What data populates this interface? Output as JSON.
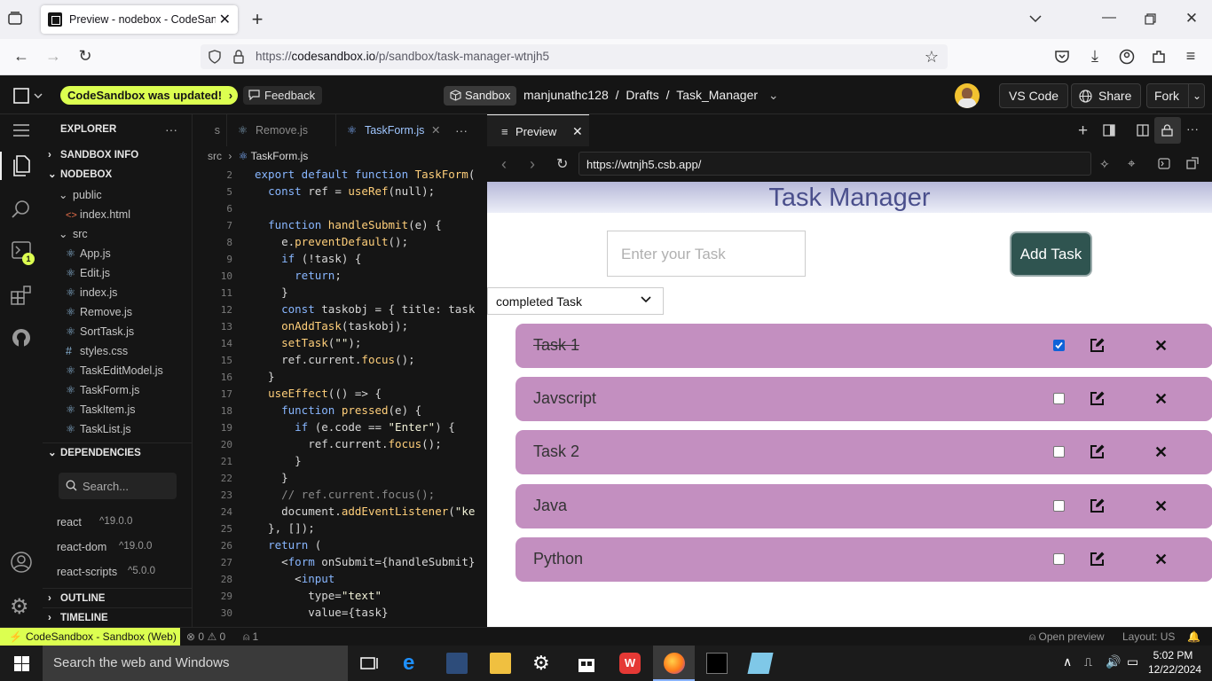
{
  "browser": {
    "tab_title": "Preview - nodebox - CodeSandbox",
    "url": "https://codesandbox.io/p/sandbox/task-manager-wtnjh5",
    "url_host": "codesandbox.io",
    "url_prefix": "https://",
    "url_path": "/p/sandbox/task-manager-wtnjh5"
  },
  "csb_header": {
    "updated_label": "CodeSandbox was updated!",
    "feedback_label": "Feedback",
    "sandbox_label": "Sandbox",
    "breadcrumb": [
      "manjunathc128",
      "/",
      "Drafts",
      "/",
      "Task_Manager"
    ],
    "vscode_label": "VS Code",
    "share_label": "Share",
    "fork_label": "Fork"
  },
  "explorer": {
    "title": "EXPLORER",
    "sections": {
      "sandbox_info": "SANDBOX INFO",
      "nodebox": "NODEBOX",
      "dependencies": "DEPENDENCIES",
      "outline": "OUTLINE",
      "timeline": "TIMELINE"
    },
    "public_folder": "public",
    "public_files": [
      "index.html"
    ],
    "src_folder": "src",
    "src_files": [
      "App.js",
      "Edit.js",
      "index.js",
      "Remove.js",
      "SortTask.js",
      "styles.css",
      "TaskEditModel.js",
      "TaskForm.js",
      "TaskItem.js",
      "TaskList.js"
    ],
    "search_placeholder": "Search...",
    "dependencies": [
      {
        "name": "react",
        "version": "^19.0.0"
      },
      {
        "name": "react-dom",
        "version": "^19.0.0"
      },
      {
        "name": "react-scripts",
        "version": "^5.0.0"
      }
    ]
  },
  "editor": {
    "tabs": [
      "s",
      "Remove.js",
      "TaskForm.js"
    ],
    "breadcrumb": [
      "src",
      "TaskForm.js"
    ],
    "lines": [
      {
        "n": "2",
        "tokens": [
          [
            "kw",
            "export default function "
          ],
          [
            "fn",
            "TaskForm"
          ],
          [
            "",
            "("
          ]
        ]
      },
      {
        "n": "5",
        "tokens": [
          [
            "",
            "  "
          ],
          [
            "kw",
            "const "
          ],
          [
            "",
            "ref = "
          ],
          [
            "fn",
            "useRef"
          ],
          [
            "",
            "(null);"
          ]
        ]
      },
      {
        "n": "6",
        "tokens": [
          [
            "",
            ""
          ]
        ]
      },
      {
        "n": "7",
        "tokens": [
          [
            "",
            "  "
          ],
          [
            "kw",
            "function "
          ],
          [
            "fn",
            "handleSubmit"
          ],
          [
            "",
            "(e) {"
          ]
        ]
      },
      {
        "n": "8",
        "tokens": [
          [
            "",
            "    e."
          ],
          [
            "fn",
            "preventDefault"
          ],
          [
            "",
            "();"
          ]
        ]
      },
      {
        "n": "9",
        "tokens": [
          [
            "",
            "    "
          ],
          [
            "kw",
            "if "
          ],
          [
            "",
            "(!task) {"
          ]
        ]
      },
      {
        "n": "10",
        "tokens": [
          [
            "",
            "      "
          ],
          [
            "kw",
            "return"
          ],
          [
            "",
            ";"
          ]
        ]
      },
      {
        "n": "11",
        "tokens": [
          [
            "",
            "    }"
          ]
        ]
      },
      {
        "n": "12",
        "tokens": [
          [
            "",
            "    "
          ],
          [
            "kw",
            "const "
          ],
          [
            "",
            "taskobj = { title: task"
          ]
        ]
      },
      {
        "n": "13",
        "tokens": [
          [
            "",
            "    "
          ],
          [
            "fn",
            "onAddTask"
          ],
          [
            "",
            "(taskobj);"
          ]
        ]
      },
      {
        "n": "14",
        "tokens": [
          [
            "",
            "    "
          ],
          [
            "fn",
            "setTask"
          ],
          [
            "",
            "("
          ],
          [
            "str",
            "\"\""
          ],
          [
            "",
            ");"
          ]
        ]
      },
      {
        "n": "15",
        "tokens": [
          [
            "",
            "    ref.current."
          ],
          [
            "fn",
            "focus"
          ],
          [
            "",
            "();"
          ]
        ]
      },
      {
        "n": "16",
        "tokens": [
          [
            "",
            "  }"
          ]
        ]
      },
      {
        "n": "17",
        "tokens": [
          [
            "",
            "  "
          ],
          [
            "fn",
            "useEffect"
          ],
          [
            "",
            "(() => {"
          ]
        ]
      },
      {
        "n": "18",
        "tokens": [
          [
            "",
            "    "
          ],
          [
            "kw",
            "function "
          ],
          [
            "fn",
            "pressed"
          ],
          [
            "",
            "(e) {"
          ]
        ]
      },
      {
        "n": "19",
        "tokens": [
          [
            "",
            "      "
          ],
          [
            "kw",
            "if "
          ],
          [
            "",
            "(e.code == "
          ],
          [
            "str",
            "\"Enter\""
          ],
          [
            "",
            ") {"
          ]
        ]
      },
      {
        "n": "20",
        "tokens": [
          [
            "",
            "        ref.current."
          ],
          [
            "fn",
            "focus"
          ],
          [
            "",
            "();"
          ]
        ]
      },
      {
        "n": "21",
        "tokens": [
          [
            "",
            "      }"
          ]
        ]
      },
      {
        "n": "22",
        "tokens": [
          [
            "",
            "    }"
          ]
        ]
      },
      {
        "n": "23",
        "tokens": [
          [
            "cm",
            "    // ref.current.focus();"
          ]
        ]
      },
      {
        "n": "24",
        "tokens": [
          [
            "",
            "    document."
          ],
          [
            "fn",
            "addEventListener"
          ],
          [
            "",
            "("
          ],
          [
            "str",
            "\"ke"
          ]
        ]
      },
      {
        "n": "25",
        "tokens": [
          [
            "",
            "  }, []);"
          ]
        ]
      },
      {
        "n": "26",
        "tokens": [
          [
            "",
            "  "
          ],
          [
            "kw",
            "return "
          ],
          [
            "",
            "("
          ]
        ]
      },
      {
        "n": "27",
        "tokens": [
          [
            "",
            "    <"
          ],
          [
            "kw",
            "form "
          ],
          [
            "",
            "onSubmit={handleSubmit}"
          ]
        ]
      },
      {
        "n": "28",
        "tokens": [
          [
            "",
            "      <"
          ],
          [
            "kw",
            "input"
          ]
        ]
      },
      {
        "n": "29",
        "tokens": [
          [
            "",
            "        type="
          ],
          [
            "str",
            "\"text\""
          ]
        ]
      },
      {
        "n": "30",
        "tokens": [
          [
            "",
            "        value={task}"
          ]
        ]
      }
    ]
  },
  "preview": {
    "tab_label": "Preview",
    "url": "https://wtnjh5.csb.app/",
    "app": {
      "heading": "Task Manager",
      "input_placeholder": "Enter your Task",
      "add_button": "Add Task",
      "filter_value": "completed Task",
      "tasks": [
        {
          "title": "Task 1",
          "completed": true
        },
        {
          "title": "Javscript",
          "completed": false
        },
        {
          "title": "Task 2",
          "completed": false
        },
        {
          "title": "Java",
          "completed": false
        },
        {
          "title": "Python",
          "completed": false
        }
      ]
    }
  },
  "statusbar": {
    "branch": "CodeSandbox - Sandbox (Web)",
    "errors": "0",
    "warnings": "0",
    "ports": "1",
    "open_preview": "Open preview",
    "layout": "Layout: US"
  },
  "taskbar": {
    "search_placeholder": "Search the web and Windows",
    "time": "5:02 PM",
    "date": "12/22/2024"
  },
  "colors": {
    "accent": "#dcff50",
    "task_bg": "#c38fc0",
    "add_btn": "#2f5450",
    "heading": "#4a4f8c"
  }
}
